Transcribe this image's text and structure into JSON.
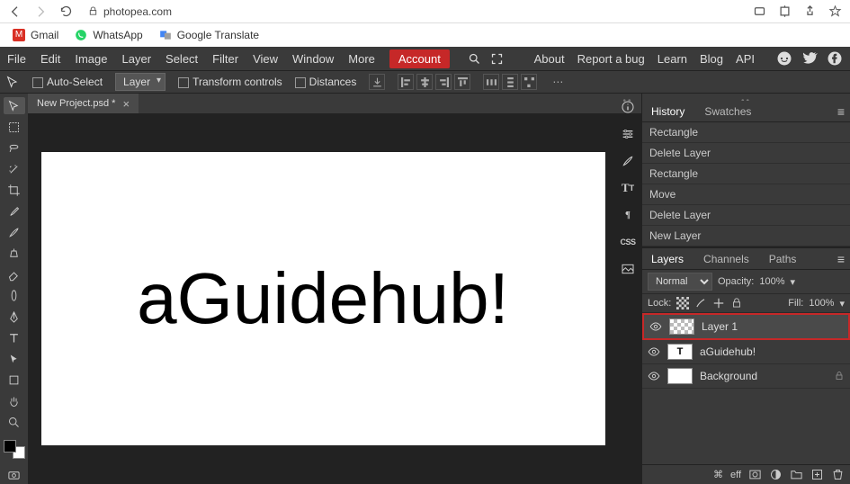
{
  "browser": {
    "url": "photopea.com"
  },
  "bookmarks": [
    {
      "label": "Gmail",
      "color": "#d93025",
      "letter": "M"
    },
    {
      "label": "WhatsApp",
      "color": "#25d366",
      "letter": ""
    },
    {
      "label": "Google Translate",
      "color": "#4285f4",
      "letter": "G"
    }
  ],
  "menu": {
    "items": [
      "File",
      "Edit",
      "Image",
      "Layer",
      "Select",
      "Filter",
      "View",
      "Window",
      "More"
    ],
    "account": "Account",
    "right": [
      "About",
      "Report a bug",
      "Learn",
      "Blog",
      "API"
    ]
  },
  "optbar": {
    "autoSelect": "Auto-Select",
    "layerSel": "Layer",
    "transform": "Transform controls",
    "distances": "Distances"
  },
  "tabs": [
    {
      "title": "New Project.psd *"
    }
  ],
  "canvasText": "aGuidehub!",
  "historyPanel": {
    "tabs": [
      "History",
      "Swatches"
    ],
    "items": [
      "Rectangle",
      "Delete Layer",
      "Rectangle",
      "Move",
      "Delete Layer",
      "New Layer"
    ]
  },
  "layersPanel": {
    "tabs": [
      "Layers",
      "Channels",
      "Paths"
    ],
    "blendMode": "Normal",
    "opacityLabel": "Opacity:",
    "opacityVal": "100%",
    "lockLabel": "Lock:",
    "fillLabel": "Fill:",
    "fillVal": "100%",
    "layers": [
      {
        "name": "Layer 1",
        "type": "checker",
        "highlight": true
      },
      {
        "name": "aGuidehub!",
        "type": "text"
      },
      {
        "name": "Background",
        "type": "white",
        "locked": true
      }
    ],
    "footLink": "eff"
  }
}
